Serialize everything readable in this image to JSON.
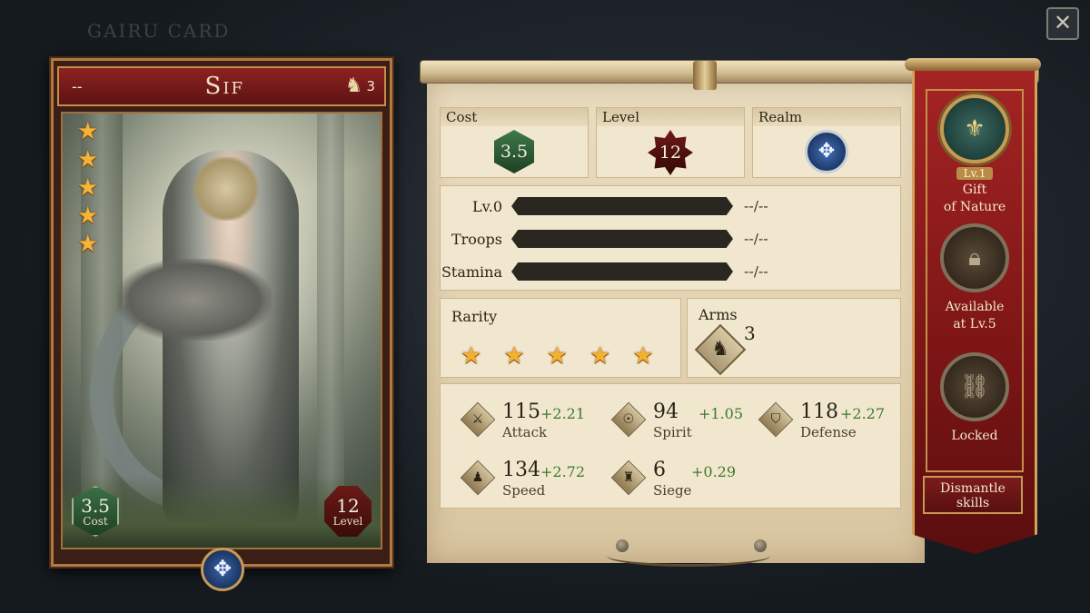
{
  "ghost_title": "GAIRU CARD",
  "close_icon": "close-x-icon",
  "card": {
    "dash": "--",
    "name": "Sif",
    "arms_icon": "horse-head-icon",
    "arms_count": "3",
    "stars": 5,
    "cost_value": "3.5",
    "cost_label": "Cost",
    "level_value": "12",
    "level_label": "Level",
    "realm_icon": "tree-emblem-icon"
  },
  "info": {
    "cost": {
      "label": "Cost",
      "value": "3.5"
    },
    "level": {
      "label": "Level",
      "value": "12"
    },
    "realm": {
      "label": "Realm",
      "icon": "tree-emblem-icon"
    },
    "bars": [
      {
        "label": "Lv.0",
        "value": "--/--"
      },
      {
        "label": "Troops",
        "value": "--/--"
      },
      {
        "label": "Stamina",
        "value": "--/--"
      }
    ],
    "rarity": {
      "label": "Rarity",
      "stars": 5
    },
    "arms": {
      "label": "Arms",
      "value": "3",
      "icon": "horse-head-icon"
    },
    "attributes": [
      {
        "name": "Attack",
        "value": "115",
        "bonus": "+2.21",
        "icon": "sword-icon"
      },
      {
        "name": "Spirit",
        "value": "94",
        "bonus": "+1.05",
        "icon": "helmet-icon"
      },
      {
        "name": "Defense",
        "value": "118",
        "bonus": "+2.27",
        "icon": "shield-icon"
      },
      {
        "name": "Speed",
        "value": "134",
        "bonus": "+2.72",
        "icon": "boot-icon"
      },
      {
        "name": "Siege",
        "value": "6",
        "bonus": "+0.29",
        "icon": "castle-icon"
      }
    ]
  },
  "skills": [
    {
      "level": "Lv.1",
      "name_line1": "Gift",
      "name_line2": "of Nature",
      "icon": "skill-crest-icon",
      "state": "active"
    },
    {
      "level": "",
      "name_line1": "Available",
      "name_line2": "at Lv.5",
      "icon": "lock-icon",
      "state": "locked"
    },
    {
      "level": "",
      "name_line1": "Locked",
      "name_line2": "",
      "icon": "chained-lock-icon",
      "state": "locked"
    }
  ],
  "dismantle": {
    "line1": "Dismantle",
    "line2": "skills"
  },
  "colors": {
    "banner_red": "#8e1c1c",
    "parchment": "#e9dcc0",
    "bonus_green": "#3d7a2c",
    "star_gold": "#f2b43a"
  }
}
